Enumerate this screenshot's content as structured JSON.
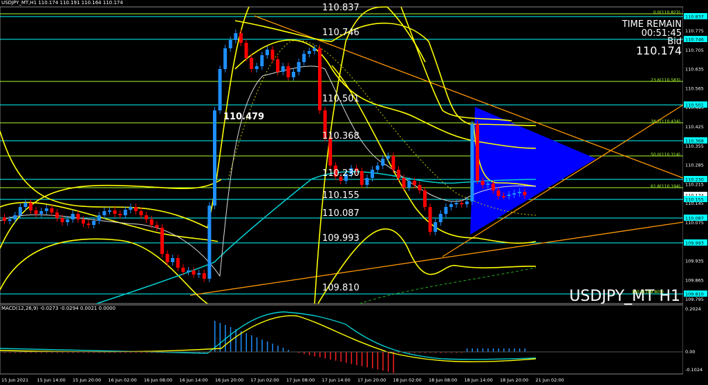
{
  "header": {
    "symbol_line": "USDJPY_MT,H1  110.174 110.191 110.164 110.174"
  },
  "timer": {
    "label": "TIME REMAIN",
    "value": "00:51:45"
  },
  "bid": {
    "label": "Bid",
    "value": "110.174"
  },
  "watermark": "USDJPY_MT H1",
  "macd_header": "MACD(12,26,9) -0.0273 -0.0294 0.0021 0.0000",
  "price_levels": [
    {
      "text": "110.837",
      "key": "110837"
    },
    {
      "text": "110.746",
      "key": "110746"
    },
    {
      "text": "110.479",
      "key": "110479"
    },
    {
      "text": "110.501",
      "key": "110501"
    },
    {
      "text": "110.368",
      "key": "110368"
    },
    {
      "text": "110.230",
      "key": "110230"
    },
    {
      "text": "110.155",
      "key": "110155"
    },
    {
      "text": "110.087",
      "key": "110087"
    },
    {
      "text": "109.993",
      "key": "109993"
    },
    {
      "text": "109.810",
      "key": "109810"
    }
  ],
  "fib_labels": [
    "0.0(110.823)",
    "23.6(110.583)",
    "38.2(110.434)",
    "50.0(110.314)",
    "61.8(110.194)",
    "100.0(109.805)"
  ],
  "y_axis": {
    "ticks": [
      "110.775",
      "110.705",
      "110.635",
      "110.565",
      "110.495",
      "110.425",
      "110.355",
      "110.285",
      "110.215",
      "110.145",
      "110.075",
      "110.005",
      "109.935",
      "109.865",
      "109.795"
    ],
    "tags": [
      "110.837",
      "110.746",
      "110.501",
      "110.368",
      "110.230",
      "110.174",
      "110.155",
      "110.087",
      "109.993",
      "109.810"
    ]
  },
  "macd_axis": [
    "0.2024",
    "0.00",
    "-0.1024"
  ],
  "x_axis": [
    "15 Jun 2021",
    "15 Jun 14:00",
    "15 Jun 20:00",
    "16 Jun 02:00",
    "16 Jun 08:00",
    "16 Jun 14:00",
    "16 Jun 20:00",
    "17 Jun 02:00",
    "17 Jun 08:00",
    "17 Jun 14:00",
    "17 Jun 20:00",
    "18 Jun 02:00",
    "18 Jun 08:00",
    "18 Jun 14:00",
    "18 Jun 20:00",
    "21 Jun 02:00"
  ],
  "colors": {
    "bull": "#1e90ff",
    "bear": "#ff0000",
    "band": "#ffff00",
    "ma": "#00ced1",
    "trend": "#ff9900",
    "triangle": "#0000ff",
    "fib": "#adff2f",
    "hline": "#00ffff"
  }
}
